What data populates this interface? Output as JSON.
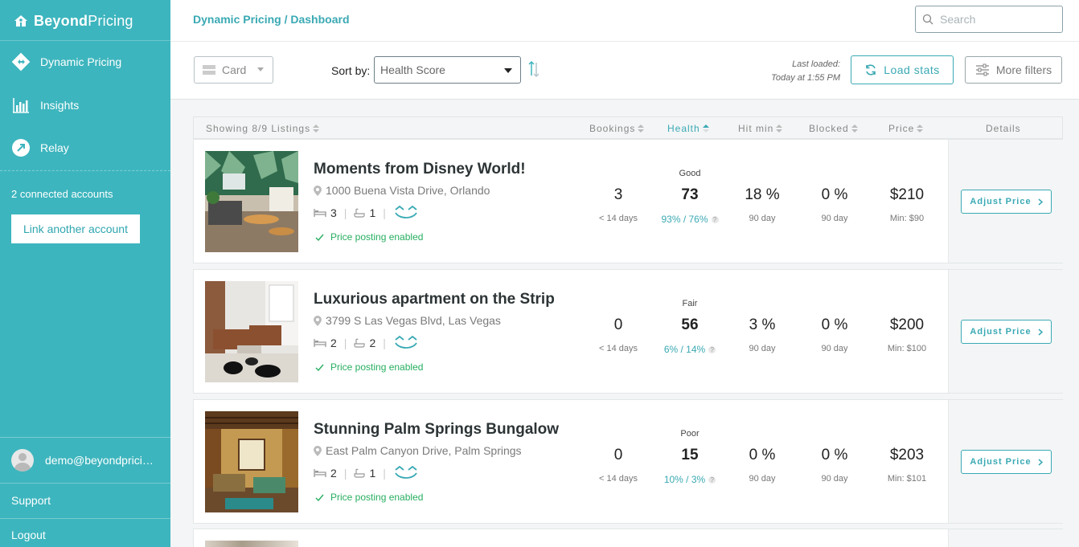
{
  "brand": {
    "bold": "Beyond",
    "light": "Pricing"
  },
  "sidebar": {
    "items": [
      {
        "label": "Dynamic Pricing",
        "icon": "diamond-arrows-icon"
      },
      {
        "label": "Insights",
        "icon": "bar-chart-icon"
      },
      {
        "label": "Relay",
        "icon": "relay-icon"
      }
    ],
    "connected": "2 connected accounts",
    "link_button": "Link another account",
    "user_email": "demo@beyondpricing.com",
    "support": "Support",
    "logout": "Logout"
  },
  "header": {
    "breadcrumb": "Dynamic Pricing / Dashboard",
    "search_placeholder": "Search"
  },
  "toolbar": {
    "view_value": "Card",
    "sort_label": "Sort by:",
    "sort_value": "Health Score",
    "last_loaded_line1": "Last loaded:",
    "last_loaded_line2": "Today at 1:55 PM",
    "load_stats": "Load stats",
    "more_filters": "More filters"
  },
  "table": {
    "showing": "Showing 8/9 Listings",
    "columns": {
      "bookings": "Bookings",
      "health": "Health",
      "hit_min": "Hit min",
      "blocked": "Blocked",
      "price": "Price",
      "details": "Details"
    }
  },
  "listings": [
    {
      "title": "Moments from Disney World!",
      "address": "1000 Buena Vista Drive, Orlando",
      "beds": "3",
      "baths": "1",
      "posting": "Price posting enabled",
      "bookings": "3",
      "bookings_sub": "< 14 days",
      "rating": "Good",
      "health": "73",
      "health_sub": "93% / 76%",
      "hit_min": "18 %",
      "hit_min_sub": "90 day",
      "blocked": "0 %",
      "blocked_sub": "90 day",
      "price": "$210",
      "min_price": "Min: $90",
      "adjust": "Adjust Price"
    },
    {
      "title": "Luxurious apartment on the Strip",
      "address": "3799 S Las Vegas Blvd, Las Vegas",
      "beds": "2",
      "baths": "2",
      "posting": "Price posting enabled",
      "bookings": "0",
      "bookings_sub": "< 14 days",
      "rating": "Fair",
      "health": "56",
      "health_sub": "6% / 14%",
      "hit_min": "3 %",
      "hit_min_sub": "90 day",
      "blocked": "0 %",
      "blocked_sub": "90 day",
      "price": "$200",
      "min_price": "Min: $100",
      "adjust": "Adjust Price"
    },
    {
      "title": "Stunning Palm Springs Bungalow",
      "address": "East Palm Canyon Drive, Palm Springs",
      "beds": "2",
      "baths": "1",
      "posting": "Price posting enabled",
      "bookings": "0",
      "bookings_sub": "< 14 days",
      "rating": "Poor",
      "health": "15",
      "health_sub": "10% / 3%",
      "hit_min": "0 %",
      "hit_min_sub": "90 day",
      "blocked": "0 %",
      "blocked_sub": "90 day",
      "price": "$203",
      "min_price": "Min: $101",
      "adjust": "Adjust Price"
    }
  ],
  "colors": {
    "sidebar": "#3db5be",
    "accent": "#3aa9b4",
    "success": "#27ae60"
  }
}
